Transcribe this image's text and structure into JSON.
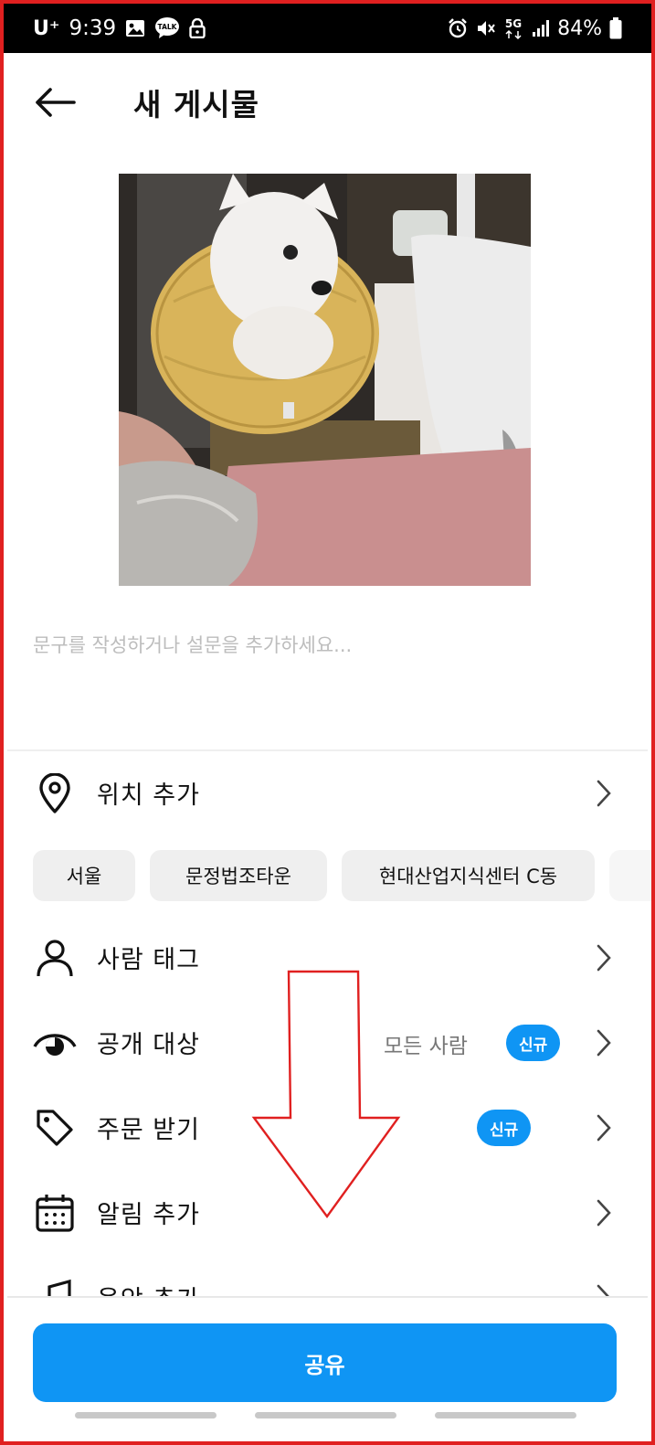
{
  "status_bar": {
    "carrier": "U⁺",
    "time": "9:39",
    "battery": "84%",
    "left_icons": [
      "image-icon",
      "kakaotalk-icon",
      "lock-icon"
    ],
    "right_icons": [
      "alarm-icon",
      "mute-icon",
      "5g-icon",
      "signal-icon",
      "battery-icon"
    ],
    "talk_label": "TALK",
    "network_label": "5G"
  },
  "header": {
    "title": "새 게시물",
    "back_icon": "back-arrow-icon"
  },
  "composer": {
    "caption_placeholder": "문구를 작성하거나 설문을 추가하세요..."
  },
  "rows": {
    "location": {
      "label": "위치 추가",
      "icon": "location-pin-icon"
    },
    "tag_people": {
      "label": "사람 태그",
      "icon": "person-icon"
    },
    "audience": {
      "label": "공개 대상",
      "value": "모든 사람",
      "badge": "신규",
      "icon": "eye-icon"
    },
    "orders": {
      "label": "주문 받기",
      "badge": "신규",
      "icon": "tag-icon"
    },
    "reminder": {
      "label": "알림 추가",
      "icon": "calendar-icon"
    },
    "music": {
      "label": "음악 추가",
      "icon": "music-icon"
    }
  },
  "location_chips": [
    "서울",
    "문정법조타운",
    "현대산업지식센터 C동"
  ],
  "share_button": {
    "label": "공유"
  },
  "colors": {
    "accent": "#0f95f4",
    "annotation_red": "#e02020",
    "placeholder_gray": "#bdbdbd"
  }
}
